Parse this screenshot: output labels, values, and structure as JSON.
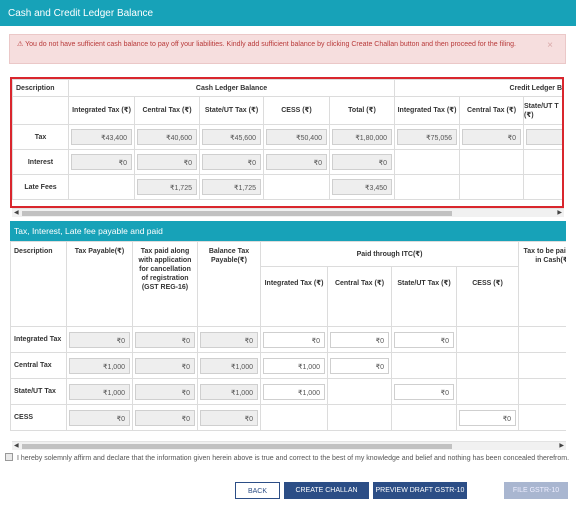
{
  "header": {
    "title": "Cash and Credit Ledger Balance"
  },
  "alert": {
    "message": "You do not have sufficient cash balance to pay off your liabilities. Kindly add sufficient balance by clicking Create Challan button and then proceed for the filing.",
    "icon": "warning-icon",
    "close": "×"
  },
  "ledger": {
    "description_header": "Description",
    "cash_ledger_header": "Cash Ledger Balance",
    "credit_ledger_header": "Credit Ledger B",
    "cols": [
      "Integrated Tax (₹)",
      "Central Tax (₹)",
      "State/UT Tax (₹)",
      "CESS (₹)",
      "Total (₹)",
      "Integrated Tax (₹)",
      "Central Tax (₹)",
      "State/UT T (₹)"
    ],
    "rows": [
      {
        "label": "Tax",
        "cash": [
          "₹43,400",
          "₹40,600",
          "₹45,600",
          "₹50,400",
          "₹1,80,000"
        ],
        "credit": [
          "₹75,056",
          "₹0",
          ""
        ]
      },
      {
        "label": "Interest",
        "cash": [
          "₹0",
          "₹0",
          "₹0",
          "₹0",
          "₹0"
        ],
        "credit": [
          "",
          "",
          ""
        ]
      },
      {
        "label": "Late Fees",
        "cash": [
          "",
          "₹1,725",
          "₹1,725",
          "",
          "₹3,450"
        ],
        "credit": [
          "",
          "",
          ""
        ]
      }
    ]
  },
  "section2": {
    "title": "Tax, Interest, Late fee payable and paid",
    "headers": {
      "description": "Description",
      "tax_payable": "Tax Payable(₹)",
      "tax_paid_app": "Tax paid along with application for cancellation of registration (GST REG-16)",
      "balance_tax": "Balance Tax Payable(₹)",
      "paid_itc": "Paid through ITC(₹)",
      "itc_cols": [
        "Integrated Tax (₹)",
        "Central Tax (₹)",
        "State/UT Tax (₹)",
        "CESS (₹)"
      ],
      "tax_cash": "Tax to be paid in Cash(₹)"
    },
    "rows": [
      {
        "label": "Integrated Tax",
        "payable": "₹0",
        "paid_app": "₹0",
        "balance": "₹0",
        "itc": [
          "₹0",
          "₹0",
          "₹0",
          ""
        ]
      },
      {
        "label": "Central Tax",
        "payable": "₹1,000",
        "paid_app": "₹0",
        "balance": "₹1,000",
        "itc": [
          "₹1,000",
          "₹0",
          "",
          ""
        ]
      },
      {
        "label": "State/UT Tax",
        "payable": "₹1,000",
        "paid_app": "₹0",
        "balance": "₹1,000",
        "itc": [
          "₹1,000",
          "",
          "₹0",
          ""
        ]
      },
      {
        "label": "CESS",
        "payable": "₹0",
        "paid_app": "₹0",
        "balance": "₹0",
        "itc": [
          "",
          "",
          "",
          "₹0"
        ]
      }
    ]
  },
  "declaration": "I hereby solemnly affirm and declare that the information given herein above is true and correct to the best of my knowledge and belief and nothing has been concealed therefrom.",
  "buttons": {
    "back": "BACK",
    "create_challan": "CREATE CHALLAN",
    "preview": "PREVIEW DRAFT GSTR-10",
    "file": "FILE GSTR-10"
  },
  "colors": {
    "header_bg": "#17a2b8",
    "alert_bg": "#f6dede",
    "highlight_border": "#d9262d",
    "primary_button": "#2c4e86"
  }
}
